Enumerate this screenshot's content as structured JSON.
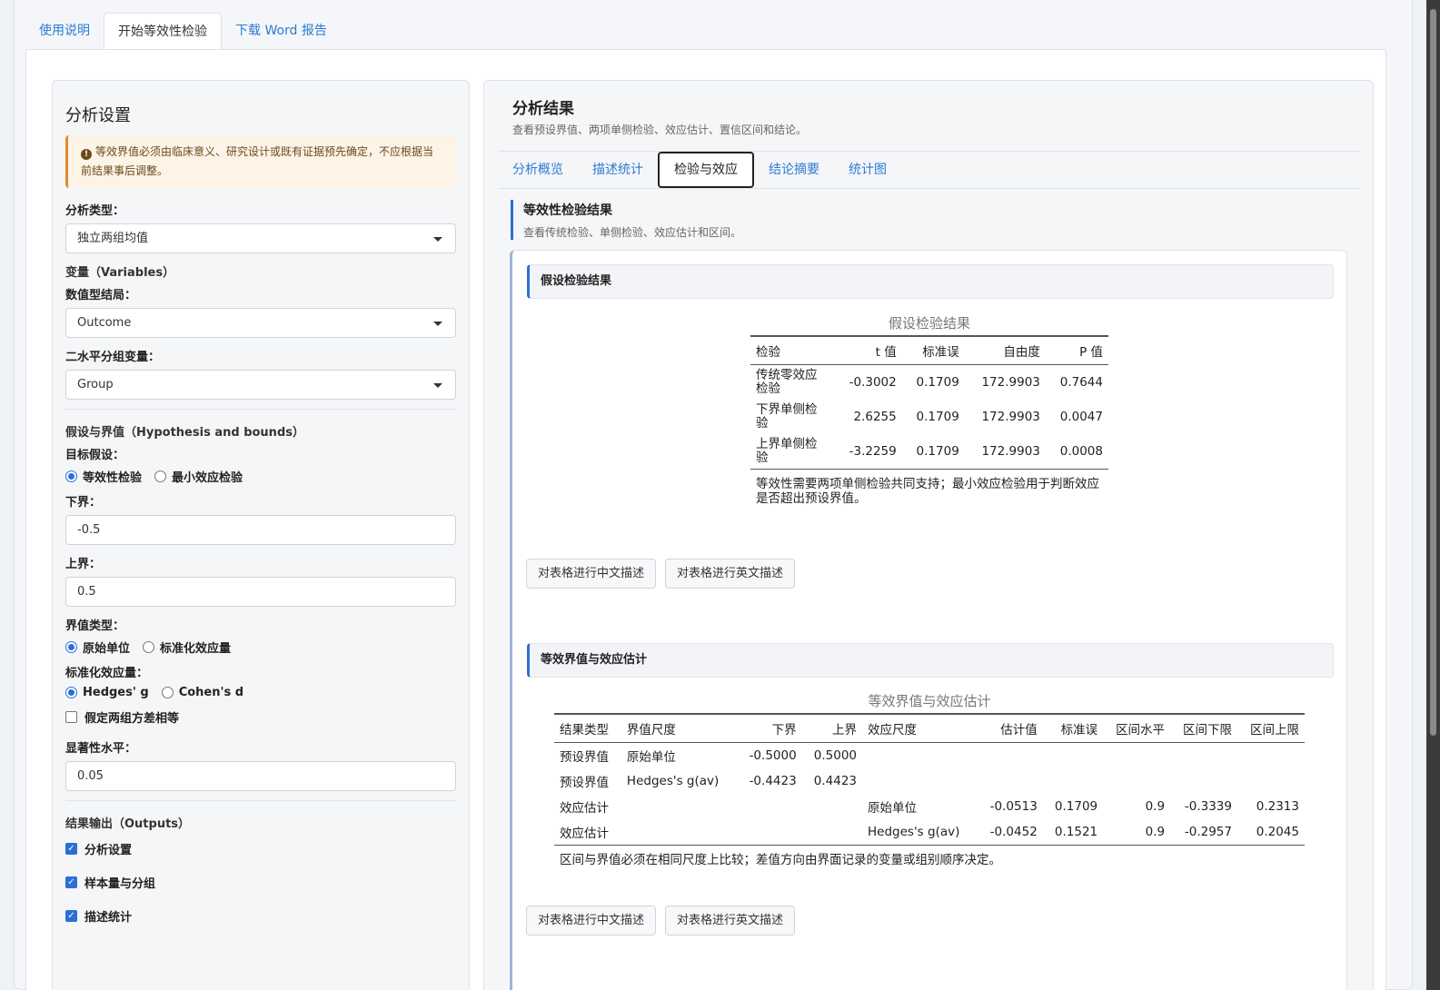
{
  "top_tabs": [
    "使用说明",
    "开始等效性检验",
    "下载 Word 报告"
  ],
  "settings": {
    "title": "分析设置",
    "warning": "等效界值必须由临床意义、研究设计或既有证据预先确定，不应根据当前结果事后调整。",
    "analysis_type_label": "分析类型：",
    "analysis_type_value": "独立两组均值",
    "variables_section": "变量（Variables）",
    "outcome_label": "数值型结局：",
    "outcome_value": "Outcome",
    "group_label": "二水平分组变量：",
    "group_value": "Group",
    "hypothesis_section": "假设与界值（Hypothesis and bounds）",
    "target_label": "目标假设：",
    "target_options": [
      "等效性检验",
      "最小效应检验"
    ],
    "lower_label": "下界：",
    "lower_value": "-0.5",
    "upper_label": "上界：",
    "upper_value": "0.5",
    "bound_type_label": "界值类型：",
    "bound_type_options": [
      "原始单位",
      "标准化效应量"
    ],
    "std_label": "标准化效应量：",
    "std_options": [
      "Hedges' g",
      "Cohen's d"
    ],
    "equal_var_label": "假定两组方差相等",
    "alpha_label": "显著性水平：",
    "alpha_value": "0.05",
    "outputs_section": "结果输出（Outputs）",
    "outputs": [
      "分析设置",
      "样本量与分组",
      "描述统计"
    ]
  },
  "results": {
    "title": "分析结果",
    "subtitle": "查看预设界值、两项单侧检验、效应估计、置信区间和结论。",
    "tabs": [
      "分析概览",
      "描述统计",
      "检验与效应",
      "结论摘要",
      "统计图"
    ],
    "section_title": "等效性检验结果",
    "section_sub": "查看传统检验、单侧检验、效应估计和区间。",
    "block1": {
      "head": "假设检验结果",
      "caption": "假设检验结果",
      "columns": [
        "检验",
        "t 值",
        "标准误",
        "自由度",
        "P 值"
      ],
      "rows": [
        [
          "传统零效应检验",
          "-0.3002",
          "0.1709",
          "172.9903",
          "0.7644"
        ],
        [
          "下界单侧检验",
          "2.6255",
          "0.1709",
          "172.9903",
          "0.0047"
        ],
        [
          "上界单侧检验",
          "-3.2259",
          "0.1709",
          "172.9903",
          "0.0008"
        ]
      ],
      "note": "等效性需要两项单侧检验共同支持；最小效应检验用于判断效应是否超出预设界值。"
    },
    "block2": {
      "head": "等效界值与效应估计",
      "caption": "等效界值与效应估计",
      "columns": [
        "结果类型",
        "界值尺度",
        "下界",
        "上界",
        "效应尺度",
        "估计值",
        "标准误",
        "区间水平",
        "区间下限",
        "区间上限"
      ],
      "rows": [
        [
          "预设界值",
          "原始单位",
          "-0.5000",
          "0.5000",
          "",
          "",
          "",
          "",
          "",
          ""
        ],
        [
          "预设界值",
          "Hedges's g(av)",
          "-0.4423",
          "0.4423",
          "",
          "",
          "",
          "",
          "",
          ""
        ],
        [
          "效应估计",
          "",
          "",
          "",
          "原始单位",
          "-0.0513",
          "0.1709",
          "0.9",
          "-0.3339",
          "0.2313"
        ],
        [
          "效应估计",
          "",
          "",
          "",
          "Hedges's g(av)",
          "-0.0452",
          "0.1521",
          "0.9",
          "-0.2957",
          "0.2045"
        ]
      ],
      "note": "区间与界值必须在相同尺度上比较；差值方向由界面记录的变量或组别顺序决定。"
    },
    "btn_cn": "对表格进行中文描述",
    "btn_en": "对表格进行英文描述"
  }
}
